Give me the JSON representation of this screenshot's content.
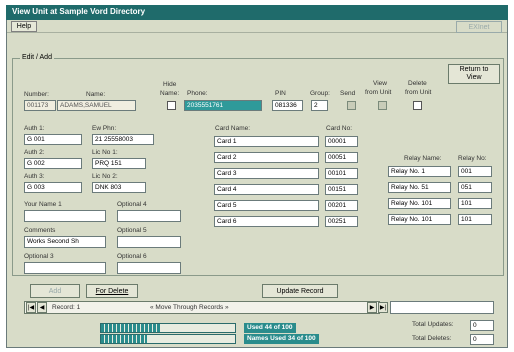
{
  "window": {
    "title": "View Unit at Sample Vord Directory"
  },
  "menu": {
    "help": "Help"
  },
  "toolbar": {
    "exit": "EXInet"
  },
  "section": {
    "label": "Edit / Add"
  },
  "top_fields": {
    "number_label": "Number:",
    "number_value": "001173",
    "name_label": "Name:",
    "name_value": "ADAMS,SAMUEL",
    "hide_name_label_1": "Hide",
    "hide_name_label_2": "Name:",
    "phone_label": "Phone:",
    "phone_value": "2035551761",
    "pin_label": "PIN",
    "pin_value": "081336",
    "group_label": "Group:",
    "group_value": "2",
    "send_label": "Send",
    "view_label_1": "View",
    "view_label_2": "from Unit",
    "delete_label_1": "Delete",
    "delete_label_2": "from Unit"
  },
  "return_button": {
    "line1": "Return to",
    "line2": "View"
  },
  "auth": [
    {
      "label": "Auth 1:",
      "value": "G 001"
    },
    {
      "label": "Auth 2:",
      "value": "G 002"
    },
    {
      "label": "Auth 3:",
      "value": "G 003"
    }
  ],
  "ems": {
    "label": "Ew Phn:",
    "value": "21 25558003"
  },
  "lic": [
    {
      "label": "Lic No 1:",
      "value": "PRQ 151"
    },
    {
      "label": "Lic No 2:",
      "value": "DNK 803"
    }
  ],
  "your_name": {
    "label": "Your Name 1",
    "value": ""
  },
  "optional_4": {
    "label": "Optional 4",
    "value": ""
  },
  "comments": {
    "label": "Comments",
    "value": "Works Second Sh"
  },
  "optional_5": {
    "label": "Optional 5",
    "value": ""
  },
  "optional_3": {
    "label": "Optional 3",
    "value": ""
  },
  "optional_6": {
    "label": "Optional 6",
    "value": ""
  },
  "cards": {
    "name_header": "Card Name:",
    "no_header": "Card No:",
    "rows": [
      {
        "name": "Card 1",
        "no": "00001"
      },
      {
        "name": "Card 2",
        "no": "00051"
      },
      {
        "name": "Card 3",
        "no": "00101"
      },
      {
        "name": "Card 4",
        "no": "00151"
      },
      {
        "name": "Card 5",
        "no": "00201"
      },
      {
        "name": "Card 6",
        "no": "00251"
      }
    ]
  },
  "relays": {
    "name_header": "Relay Name:",
    "no_header": "Relay No:",
    "rows": [
      {
        "name": "Relay No. 1",
        "no": "001"
      },
      {
        "name": "Relay No. 51",
        "no": "051"
      },
      {
        "name": "Relay No. 101",
        "no": "101"
      },
      {
        "name": "Relay No. 101",
        "no": "101"
      }
    ]
  },
  "actions": {
    "add": "Add",
    "for_delete": "For Delete",
    "update": "Update Record"
  },
  "navigator": {
    "record": "Record: 1",
    "hint": "« Move Through Records »"
  },
  "status": {
    "used": "Used 44 of 100",
    "names_used": "Names Used 34 of 100",
    "progress_used": 0.44,
    "progress_names": 0.34
  },
  "totals": {
    "updates_label": "Total Updates:",
    "updates_value": "0",
    "deletes_label": "Total Deletes:",
    "deletes_value": "0"
  }
}
